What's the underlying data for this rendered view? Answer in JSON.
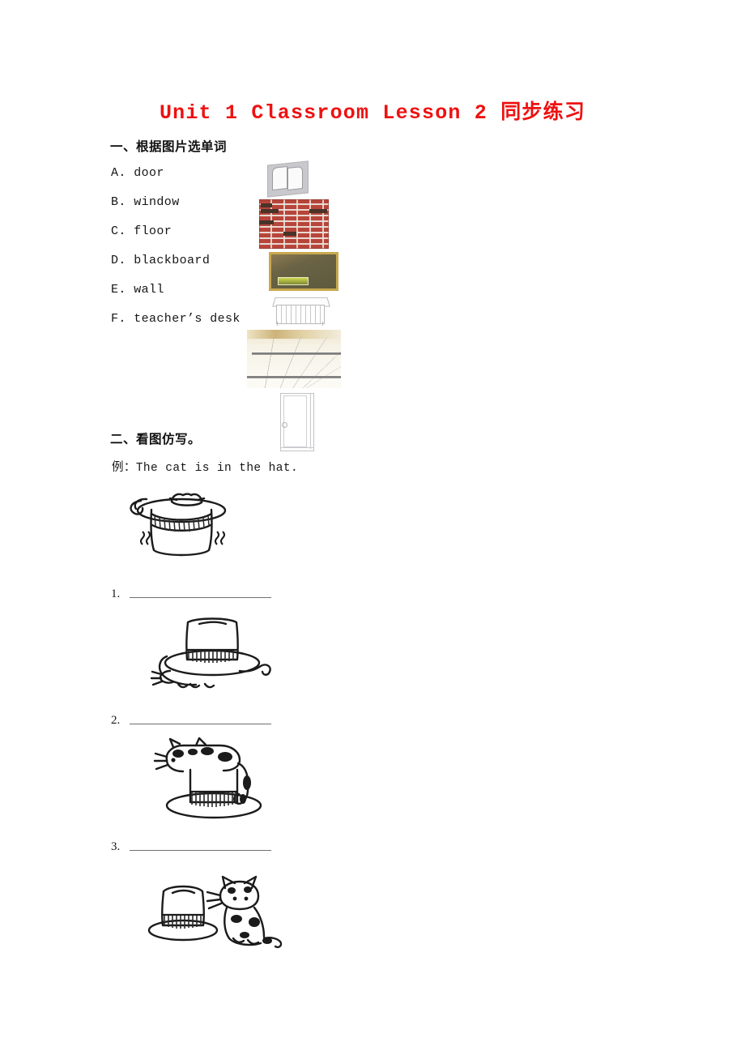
{
  "document": {
    "title": "Unit 1 Classroom Lesson 2 同步练习",
    "title_color": "#ee1111",
    "page_background": "#ffffff"
  },
  "section1": {
    "heading": "一、根据图片选单词",
    "options": [
      {
        "letter": "A.",
        "word": "door",
        "text": "A.  door"
      },
      {
        "letter": "B.",
        "word": "window",
        "text": "B.  window"
      },
      {
        "letter": "C.",
        "word": "floor",
        "text": "C.  floor"
      },
      {
        "letter": "D.",
        "word": "blackboard",
        "text": "D.  blackboard"
      },
      {
        "letter": "E.",
        "word": "wall",
        "text": "E.  wall"
      },
      {
        "letter": "F.",
        "word": "teacher's desk",
        "text": "F.  teacher’s desk"
      }
    ],
    "pictures": [
      {
        "name": "window-picture",
        "depicts": "window",
        "color": "#c9c9cd"
      },
      {
        "name": "brick-wall-picture",
        "depicts": "wall",
        "color": "#b8453a"
      },
      {
        "name": "blackboard-picture",
        "depicts": "blackboard",
        "color": "#5d5a3e"
      },
      {
        "name": "teachers-desk-picture",
        "depicts": "teacher's desk",
        "color": "#b9b9bd"
      },
      {
        "name": "floor-picture",
        "depicts": "floor",
        "color": "#ece2c8"
      },
      {
        "name": "door-picture",
        "depicts": "door",
        "color": "#c3c3c7"
      }
    ]
  },
  "section2": {
    "heading": "二、看图仿写。",
    "example_label": "例：",
    "example_sentence": "The cat is in the hat.",
    "items": [
      {
        "number": "1.",
        "answer_blank": "",
        "picture": "cat-under-hat"
      },
      {
        "number": "2.",
        "answer_blank": "",
        "picture": "cat-on-hat"
      },
      {
        "number": "3.",
        "answer_blank": "",
        "picture": "cat-next-to-hat"
      }
    ],
    "example_picture": "cat-in-hat"
  }
}
